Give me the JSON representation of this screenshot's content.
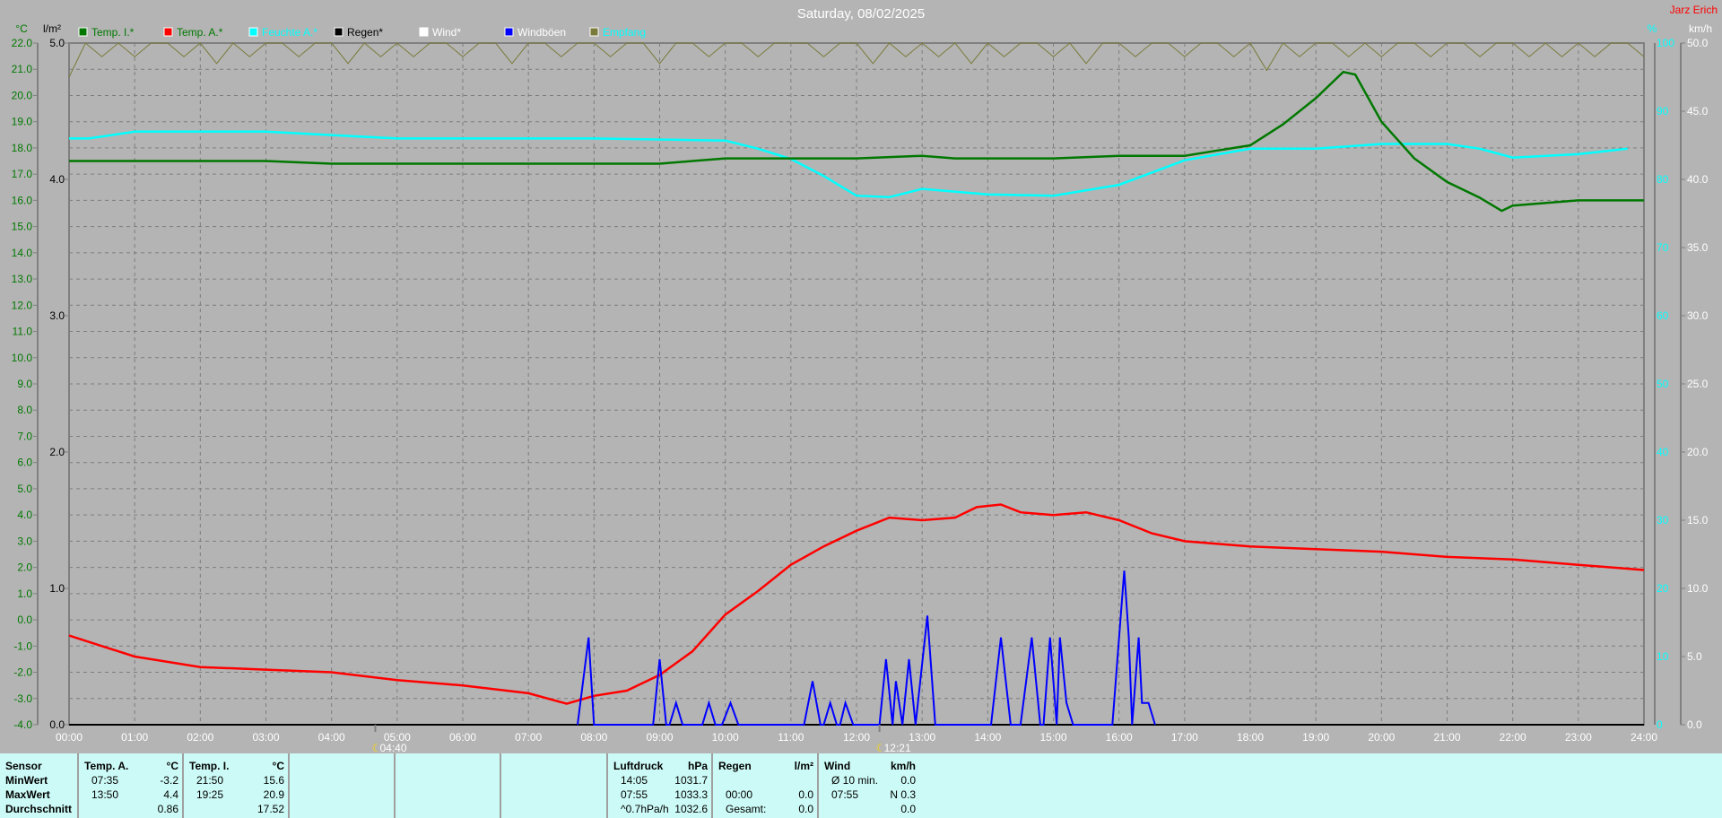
{
  "title": "Saturday, 08/02/2025",
  "author": "Jarz Erich",
  "colors": {
    "background": "#b4b4b4",
    "temp_i": "#007800",
    "temp_a": "#ff0000",
    "humidity": "#00ffff",
    "rain": "#000000",
    "wind": "#ffffff",
    "gusts": "#0000ff",
    "reception": "#7a7a3a",
    "table_bg": "#ccfaf6"
  },
  "chart_data": {
    "type": "line",
    "title": "Saturday, 08/02/2025",
    "grid": true,
    "legend_placement": "top",
    "x_unit": "time of day (hours)",
    "xlim": [
      0,
      24
    ],
    "x_ticks": [
      "00:00",
      "01:00",
      "02:00",
      "03:00",
      "04:00",
      "05:00",
      "06:00",
      "07:00",
      "08:00",
      "09:00",
      "10:00",
      "11:00",
      "12:00",
      "13:00",
      "14:00",
      "15:00",
      "16:00",
      "17:00",
      "18:00",
      "19:00",
      "20:00",
      "21:00",
      "22:00",
      "23:00",
      "24:00"
    ],
    "axes": {
      "temp": {
        "label": "°C",
        "lim": [
          -4,
          22
        ],
        "ticks": [
          "22.0",
          "21.0",
          "20.0",
          "19.0",
          "18.0",
          "17.0",
          "16.0",
          "15.0",
          "14.0",
          "13.0",
          "12.0",
          "11.0",
          "10.0",
          "9.0",
          "8.0",
          "7.0",
          "6.0",
          "5.0",
          "4.0",
          "3.0",
          "2.0",
          "1.0",
          "0.0",
          "-1.0",
          "-2.0",
          "-3.0",
          "-4.0"
        ]
      },
      "rain": {
        "label": "l/m²",
        "lim": [
          0,
          5
        ],
        "ticks": [
          "5.0",
          "4.0",
          "3.0",
          "2.0",
          "1.0",
          "0.0"
        ]
      },
      "humidity": {
        "label": "%",
        "lim": [
          0,
          100
        ],
        "ticks": [
          "100",
          "90",
          "80",
          "70",
          "60",
          "50",
          "40",
          "30",
          "20",
          "10",
          "0"
        ]
      },
      "wind": {
        "label": "km/h",
        "lim": [
          0,
          50
        ],
        "ticks": [
          "50.0",
          "45.0",
          "40.0",
          "35.0",
          "30.0",
          "25.0",
          "20.0",
          "15.0",
          "10.0",
          "5.0",
          "0.0"
        ]
      }
    },
    "markers": [
      {
        "time": 4.667,
        "label": "04:40"
      },
      {
        "time": 12.35,
        "label": "12:21"
      }
    ],
    "series": [
      {
        "name": "Temp. I.*",
        "axis": "temp",
        "color": "#007800",
        "x": [
          0,
          1,
          2,
          3,
          4,
          5,
          6,
          7,
          8,
          9,
          9.5,
          10,
          11,
          12,
          13,
          13.5,
          14,
          15,
          16,
          17,
          17.5,
          18,
          18.5,
          19,
          19.417,
          19.6,
          20,
          20.5,
          21,
          21.5,
          21.833,
          22,
          23,
          24
        ],
        "y": [
          17.5,
          17.5,
          17.5,
          17.5,
          17.4,
          17.4,
          17.4,
          17.4,
          17.4,
          17.4,
          17.5,
          17.6,
          17.6,
          17.6,
          17.7,
          17.6,
          17.6,
          17.6,
          17.7,
          17.7,
          17.9,
          18.1,
          18.9,
          19.9,
          20.9,
          20.8,
          19.0,
          17.6,
          16.7,
          16.1,
          15.6,
          15.8,
          16.0,
          16.0
        ]
      },
      {
        "name": "Temp. A.*",
        "axis": "temp",
        "color": "#ff0000",
        "x": [
          0,
          1,
          2,
          3,
          4,
          5,
          6,
          7,
          7.583,
          8,
          8.5,
          9,
          9.5,
          10,
          10.5,
          11,
          11.5,
          12,
          12.5,
          13,
          13.5,
          13.833,
          14.2,
          14.5,
          15,
          15.5,
          16,
          16.5,
          17,
          18,
          19,
          20,
          21,
          22,
          23,
          24
        ],
        "y": [
          -0.6,
          -1.4,
          -1.8,
          -1.9,
          -2.0,
          -2.3,
          -2.5,
          -2.8,
          -3.2,
          -2.9,
          -2.7,
          -2.1,
          -1.2,
          0.2,
          1.1,
          2.1,
          2.8,
          3.4,
          3.9,
          3.8,
          3.9,
          4.3,
          4.4,
          4.1,
          4.0,
          4.1,
          3.8,
          3.3,
          3.0,
          2.8,
          2.7,
          2.6,
          2.4,
          2.3,
          2.1,
          1.9
        ]
      },
      {
        "name": "Feuchte A.*",
        "axis": "humidity",
        "color": "#00ffff",
        "x": [
          0,
          0.3,
          1,
          3,
          4,
          5,
          6,
          8,
          10,
          10.5,
          11,
          11.5,
          12,
          12.5,
          13,
          14,
          15,
          16,
          16.5,
          17,
          18,
          19,
          20,
          21,
          21.5,
          22,
          23,
          23.75
        ],
        "y": [
          86,
          86,
          87,
          87,
          86.5,
          86,
          86,
          86,
          85.7,
          84.5,
          83,
          80.5,
          77.6,
          77.4,
          78.6,
          77.8,
          77.6,
          79.2,
          81,
          82.8,
          84.5,
          84.5,
          85.2,
          85.2,
          84.5,
          83.2,
          83.7,
          84.5
        ]
      },
      {
        "name": "Regen*",
        "axis": "rain",
        "color": "#000000",
        "x": [],
        "y": []
      },
      {
        "name": "Wind*",
        "axis": "wind",
        "color": "#ffffff",
        "x": [],
        "y": []
      },
      {
        "name": "Windböen",
        "axis": "wind",
        "color": "#0000ff",
        "x": [
          7.75,
          7.917,
          8.0,
          8.9,
          9.0,
          9.1,
          9.15,
          9.25,
          9.35,
          9.65,
          9.75,
          9.85,
          9.95,
          10.08,
          10.2,
          11.2,
          11.33,
          11.45,
          11.5,
          11.6,
          11.7,
          11.75,
          11.83,
          11.95,
          12.35,
          12.45,
          12.55,
          12.6,
          12.7,
          12.8,
          12.9,
          13.08,
          13.2,
          14.05,
          14.2,
          14.35,
          14.5,
          14.67,
          14.8,
          14.85,
          14.95,
          15.05,
          15.1,
          15.2,
          15.3,
          15.9,
          16.08,
          16.15,
          16.2,
          16.3,
          16.35,
          16.45,
          16.55
        ],
        "y": [
          0,
          6.4,
          0,
          0,
          4.8,
          0,
          0,
          1.6,
          0,
          0,
          1.6,
          0,
          0,
          1.6,
          0,
          0,
          3.2,
          0,
          0,
          1.6,
          0,
          0,
          1.6,
          0,
          0,
          4.8,
          0,
          3.2,
          0,
          4.8,
          0,
          8.0,
          0,
          0,
          6.4,
          0,
          0,
          6.4,
          0,
          0,
          6.4,
          0,
          6.4,
          1.6,
          0,
          0,
          11.3,
          6.4,
          0,
          6.4,
          1.6,
          1.6,
          0
        ]
      },
      {
        "name": "Empfang",
        "axis": "humidity",
        "color": "#7a7a3a",
        "x": [
          0,
          0.25,
          0.5,
          0.75,
          1,
          1.25,
          1.5,
          1.75,
          2,
          2.25,
          2.5,
          2.75,
          3,
          3.25,
          3.5,
          3.75,
          4,
          4.25,
          4.5,
          4.75,
          5,
          5.25,
          5.5,
          5.75,
          6,
          6.25,
          6.5,
          6.75,
          7,
          7.25,
          7.5,
          7.75,
          8,
          8.25,
          8.5,
          8.75,
          9,
          9.25,
          9.5,
          9.75,
          10,
          10.25,
          10.5,
          10.75,
          11,
          11.25,
          11.5,
          11.75,
          12,
          12.25,
          12.5,
          12.75,
          13,
          13.25,
          13.5,
          13.75,
          14,
          14.25,
          14.5,
          14.75,
          15,
          15.25,
          15.5,
          15.75,
          16,
          16.25,
          16.5,
          16.75,
          17,
          17.25,
          17.5,
          17.75,
          18,
          18.25,
          18.5,
          18.75,
          19,
          19.25,
          19.5,
          19.75,
          20,
          20.25,
          20.5,
          20.75,
          21,
          21.25,
          21.5,
          21.75,
          22,
          22.25,
          22.5,
          22.75,
          23,
          23.25,
          23.5,
          23.75,
          24
        ],
        "y": [
          95,
          100,
          98,
          100,
          98,
          100,
          100,
          98,
          100,
          97,
          100,
          98,
          100,
          100,
          98,
          100,
          100,
          97,
          100,
          98,
          100,
          98,
          100,
          100,
          98,
          100,
          100,
          97,
          100,
          100,
          98,
          100,
          100,
          98,
          100,
          100,
          97,
          100,
          100,
          98,
          100,
          100,
          98,
          100,
          100,
          100,
          98,
          100,
          100,
          97,
          100,
          98,
          100,
          98,
          100,
          97,
          100,
          98,
          100,
          100,
          98,
          100,
          97,
          100,
          100,
          98,
          100,
          100,
          98,
          100,
          100,
          98,
          100,
          96,
          100,
          98,
          100,
          100,
          98,
          100,
          98,
          100,
          100,
          98,
          100,
          100,
          98,
          100,
          100,
          98,
          100,
          98,
          100,
          98,
          100,
          100,
          98
        ]
      }
    ]
  },
  "legend": [
    {
      "label": "Temp. I.*",
      "color": "#007800",
      "text_color": "#007800"
    },
    {
      "label": "Temp. A.*",
      "color": "#ff0000",
      "text_color": "#007800"
    },
    {
      "label": "Feuchte A.*",
      "color": "#00ffff",
      "text_color": "#00ffff"
    },
    {
      "label": "Regen*",
      "color": "#000000",
      "text_color": "#000000"
    },
    {
      "label": "Wind*",
      "color": "#ffffff",
      "text_color": "#ffffff"
    },
    {
      "label": "Windböen",
      "color": "#0000ff",
      "text_color": "#ffffff"
    },
    {
      "label": "Empfang",
      "color": "#7a7a3a",
      "text_color": "#00ffff"
    }
  ],
  "table": {
    "sensor": {
      "header": "Sensor",
      "rows": [
        "MinWert",
        "MaxWert",
        "Durchschnitt"
      ]
    },
    "temp_a": {
      "header": "Temp. A.",
      "unit": "°C",
      "rows": [
        [
          "07:35",
          "-3.2"
        ],
        [
          "13:50",
          "4.4"
        ],
        [
          "",
          "0.86"
        ]
      ]
    },
    "temp_i": {
      "header": "Temp. I.",
      "unit": "°C",
      "rows": [
        [
          "21:50",
          "15.6"
        ],
        [
          "19:25",
          "20.9"
        ],
        [
          "",
          "17.52"
        ]
      ]
    },
    "pressure": {
      "header": "Luftdruck",
      "unit": "hPa",
      "rows": [
        [
          "14:05",
          "1031.7"
        ],
        [
          "07:55",
          "1033.3"
        ],
        [
          "^0.7hPa/h",
          "1032.6"
        ]
      ]
    },
    "rain": {
      "header": "Regen",
      "unit": "l/m²",
      "rows": [
        [
          "",
          ""
        ],
        [
          "00:00",
          "0.0"
        ],
        [
          "Gesamt:",
          "0.0"
        ]
      ]
    },
    "wind": {
      "header": "Wind",
      "unit": "km/h",
      "rows": [
        [
          "Ø 10 min.",
          "0.0"
        ],
        [
          "07:55",
          "N 0.3"
        ],
        [
          "",
          "0.0"
        ]
      ]
    }
  }
}
